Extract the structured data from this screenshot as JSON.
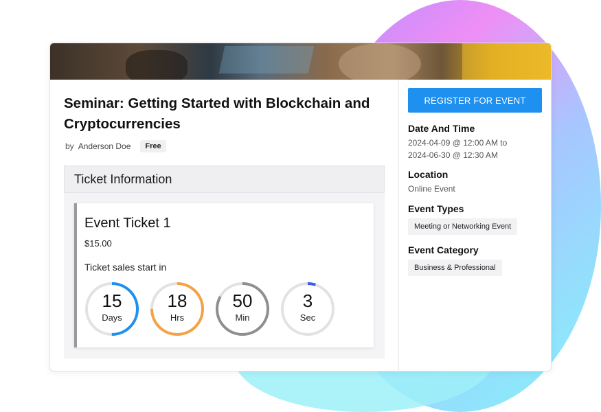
{
  "event": {
    "title": "Seminar: Getting Started with Blockchain and Cryptocurrencies",
    "by_label": "by",
    "author": "Anderson Doe",
    "price_badge": "Free"
  },
  "ticket_info": {
    "header": "Ticket Information",
    "ticket_name": "Event Ticket 1",
    "price": "$15.00",
    "sales_start_label": "Ticket sales start in",
    "countdown": [
      {
        "value": "15",
        "unit": "Days",
        "color": "#1e90f0",
        "progress": 0.5
      },
      {
        "value": "18",
        "unit": "Hrs",
        "color": "#f5a245",
        "progress": 0.75
      },
      {
        "value": "50",
        "unit": "Min",
        "color": "#8f8f8f",
        "progress": 0.83
      },
      {
        "value": "3",
        "unit": "Sec",
        "color": "#3d5af1",
        "progress": 0.05
      }
    ]
  },
  "sidebar": {
    "register_label": "REGISTER FOR EVENT",
    "date_heading": "Date And Time",
    "date_line1": "2024-04-09 @ 12:00 AM to",
    "date_line2": "2024-06-30 @ 12:30 AM",
    "location_heading": "Location",
    "location_value": "Online Event",
    "types_heading": "Event Types",
    "type_chip": "Meeting or Networking Event",
    "category_heading": "Event Category",
    "category_chip": "Business & Professional"
  },
  "colors": {
    "accent": "#1e90f0",
    "blob_gradient": [
      "#c77dff",
      "#f08cf5",
      "#9be7ff",
      "#7fd8f8"
    ]
  }
}
